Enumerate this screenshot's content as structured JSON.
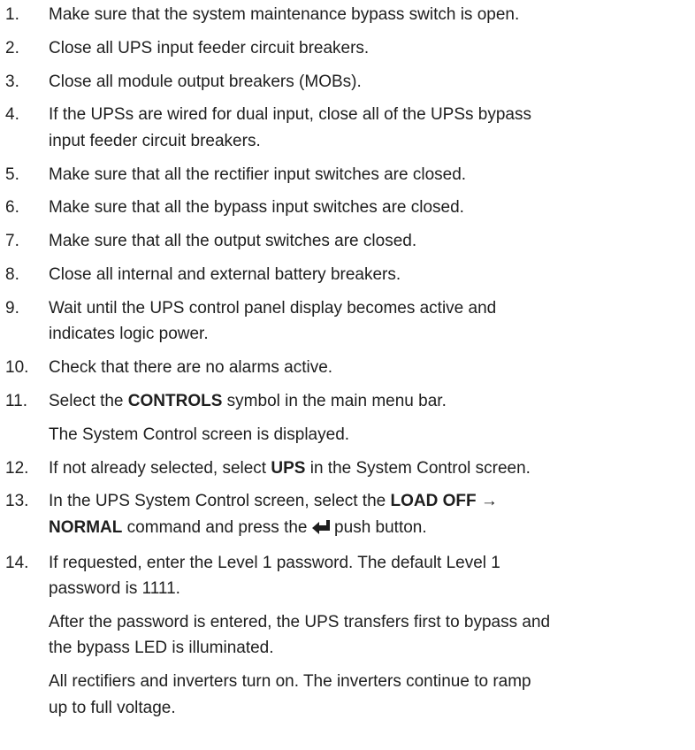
{
  "steps": [
    {
      "num": "1.",
      "text": "Make sure that the system maintenance bypass switch is open."
    },
    {
      "num": "2.",
      "text": "Close all UPS input feeder circuit breakers."
    },
    {
      "num": "3.",
      "text": "Close all module output breakers (MOBs)."
    },
    {
      "num": "4.",
      "line1": "If the UPSs are wired for dual input, close all of the UPSs bypass",
      "line2": "input feeder circuit breakers."
    },
    {
      "num": "5.",
      "text": "Make sure that all the rectifier input switches are closed."
    },
    {
      "num": "6.",
      "text": "Make sure that all the bypass input switches are closed."
    },
    {
      "num": "7.",
      "text": "Make sure that all the output switches are closed."
    },
    {
      "num": "8.",
      "text": "Close all internal and external battery breakers."
    },
    {
      "num": "9.",
      "line1": "Wait until the UPS control panel display becomes active and",
      "line2": "indicates logic power."
    },
    {
      "num": "10.",
      "text": "Check that there are no alarms active."
    },
    {
      "num": "11.",
      "pre": "Select the ",
      "bold": "CONTROLS",
      "post": " symbol in the main menu bar.",
      "note": "The System Control screen is displayed."
    },
    {
      "num": "12.",
      "pre": "If not already selected, select ",
      "bold": "UPS",
      "post": " in the System Control screen."
    },
    {
      "num": "13.",
      "pre": "In the UPS System Control screen, select the ",
      "bold1": "LOAD OFF →",
      "bold2": "NORMAL",
      "mid": " command and press the ",
      "post": " push button.",
      "icon": "enter-arrow-icon"
    },
    {
      "num": "14.",
      "line1": "If requested, enter the Level 1 password. The default Level 1",
      "line2": "password is 1111.",
      "note1_line1": "After the password is entered, the UPS transfers first to bypass and",
      "note1_line2": "the bypass LED is illuminated.",
      "note2_line1": "All rectifiers and inverters turn on. The inverters continue to ramp",
      "note2_line2": "up to full voltage."
    }
  ]
}
